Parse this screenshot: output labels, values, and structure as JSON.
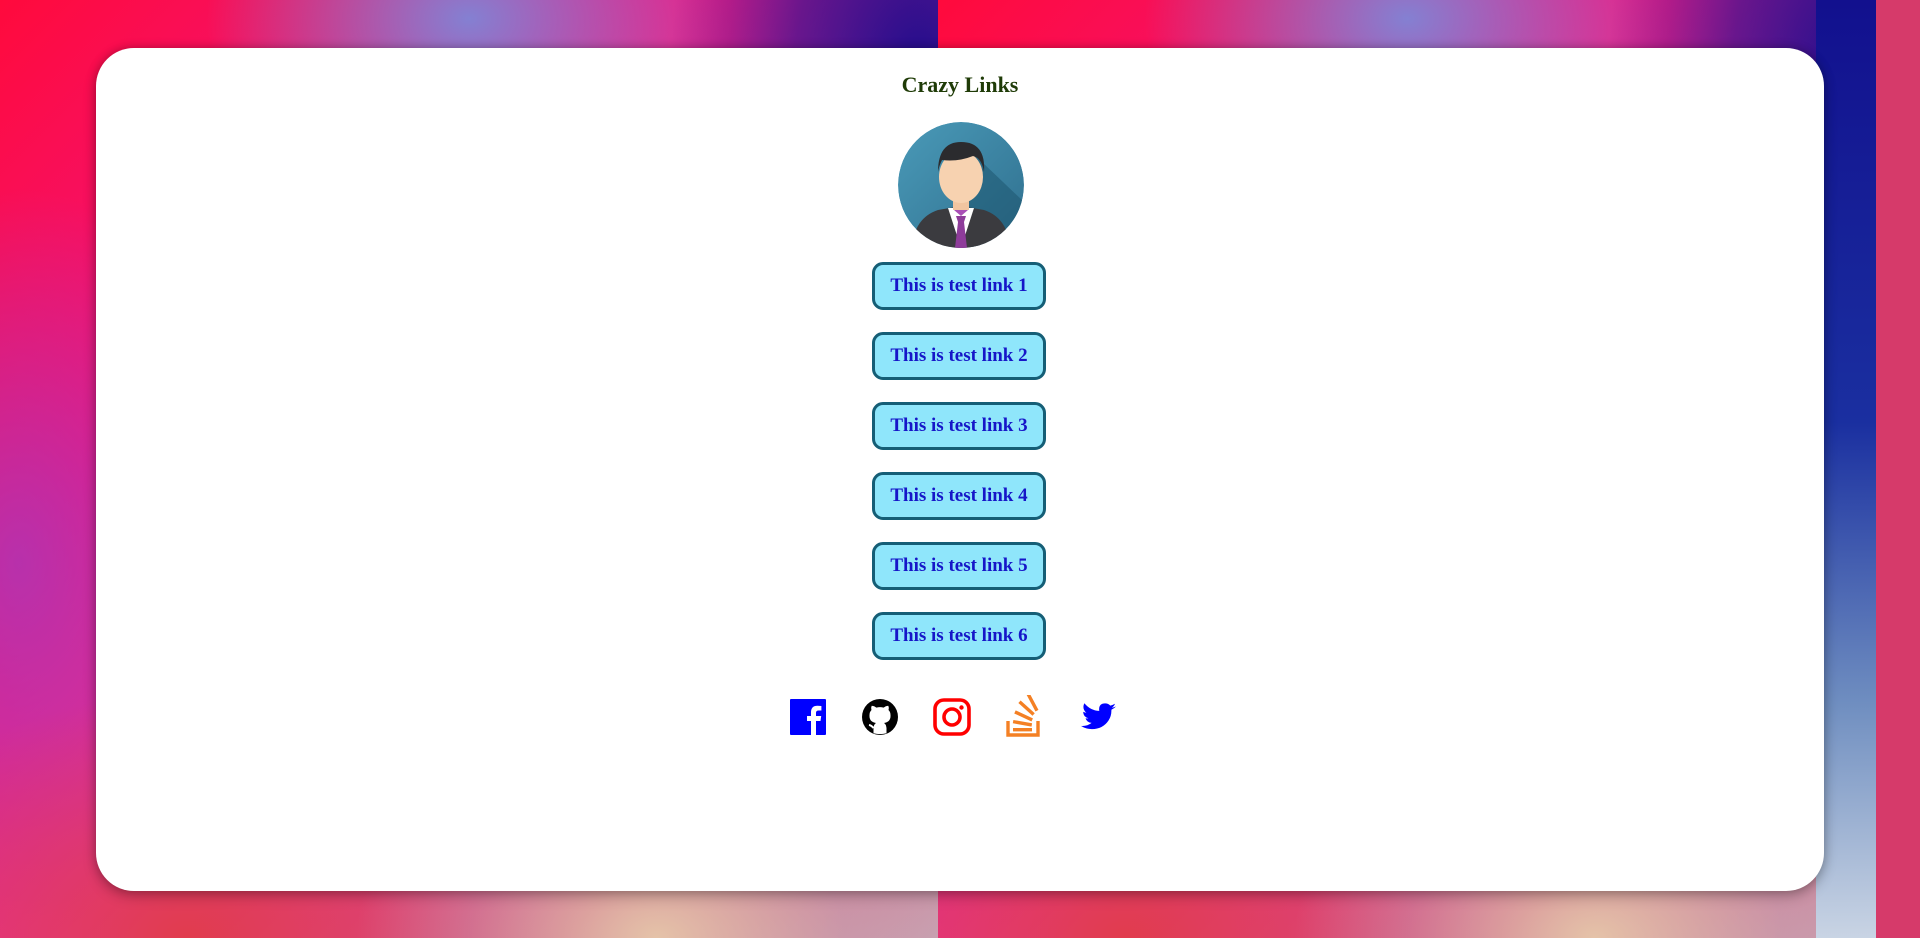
{
  "page": {
    "title": "Crazy Links"
  },
  "profile": {
    "avatar_icon": "businessman-avatar-icon"
  },
  "links": [
    {
      "label": "This is test link 1"
    },
    {
      "label": "This is test link 2"
    },
    {
      "label": "This is test link 3"
    },
    {
      "label": "This is test link 4"
    },
    {
      "label": "This is test link 5"
    },
    {
      "label": "This is test link 6"
    }
  ],
  "social": [
    {
      "icon": "facebook-icon",
      "color": "#0000ff"
    },
    {
      "icon": "github-icon",
      "color": "#000000"
    },
    {
      "icon": "instagram-icon",
      "color": "#ff0000"
    },
    {
      "icon": "stackoverflow-icon",
      "color": "#f48024"
    },
    {
      "icon": "twitter-icon",
      "color": "#0000ff"
    }
  ],
  "colors": {
    "title": "#1f3b07",
    "link_background": "#8fe6fb",
    "link_border": "#155e76",
    "link_text": "#1616c8"
  }
}
